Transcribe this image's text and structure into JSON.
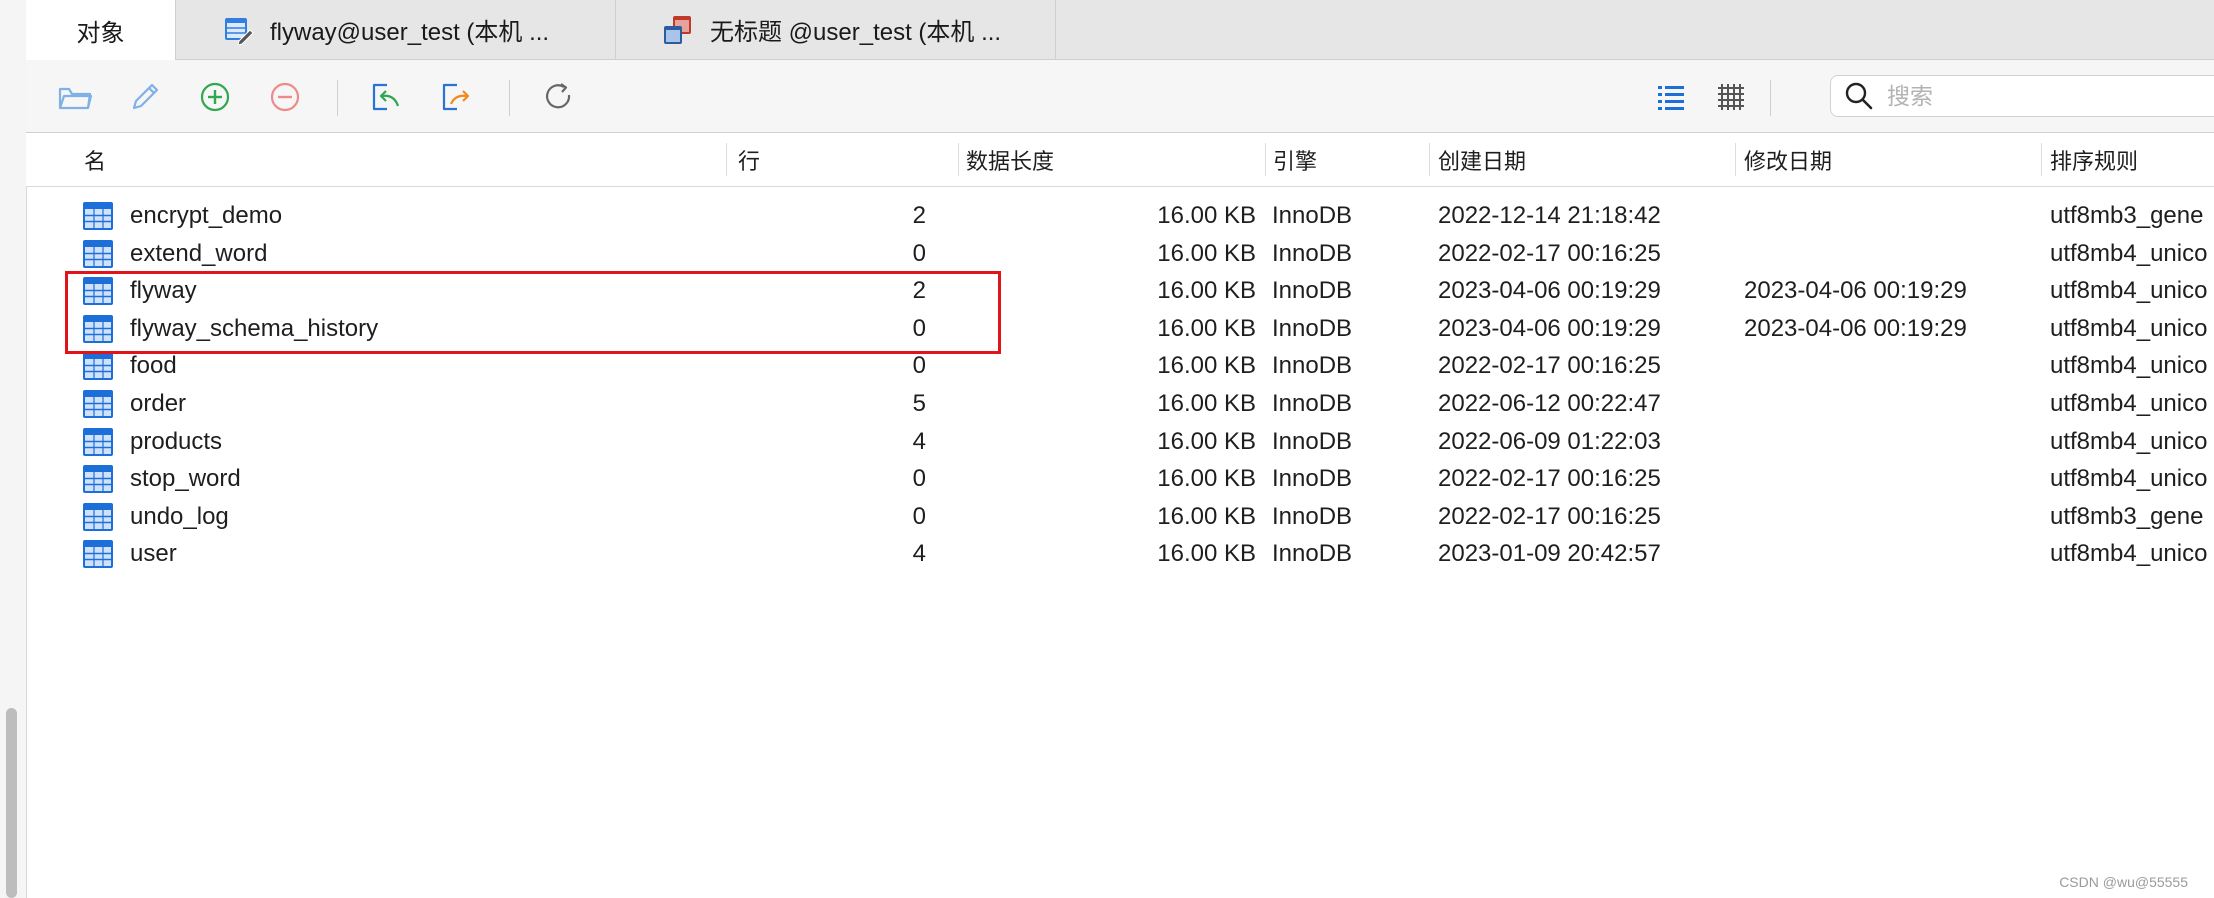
{
  "tabs": [
    {
      "label": "对象",
      "active": true,
      "icon": "objects"
    },
    {
      "label": "flyway@user_test (本机 ...",
      "active": false,
      "icon": "table-design-icon"
    },
    {
      "label": "无标题 @user_test (本机 ...",
      "active": false,
      "icon": "query-icon"
    }
  ],
  "toolbar": {
    "buttons": [
      "open-table-icon",
      "design-table-icon",
      "new-table-icon",
      "delete-table-icon",
      "import-icon",
      "export-icon",
      "refresh-icon"
    ],
    "list_view_icon": "list-view-icon",
    "grid_view_icon": "grid-view-icon"
  },
  "search": {
    "placeholder": "搜索"
  },
  "columns": {
    "name": "名",
    "rows": "行",
    "data_length": "数据长度",
    "engine": "引擎",
    "created": "创建日期",
    "modified": "修改日期",
    "collation": "排序规则"
  },
  "tables": [
    {
      "name": "encrypt_demo",
      "rows": "2",
      "data_length": "16.00 KB",
      "engine": "InnoDB",
      "created": "2022-12-14 21:18:42",
      "modified": "",
      "collation": "utf8mb3_gene"
    },
    {
      "name": "extend_word",
      "rows": "0",
      "data_length": "16.00 KB",
      "engine": "InnoDB",
      "created": "2022-02-17 00:16:25",
      "modified": "",
      "collation": "utf8mb4_unico"
    },
    {
      "name": "flyway",
      "rows": "2",
      "data_length": "16.00 KB",
      "engine": "InnoDB",
      "created": "2023-04-06 00:19:29",
      "modified": "2023-04-06 00:19:29",
      "collation": "utf8mb4_unico"
    },
    {
      "name": "flyway_schema_history",
      "rows": "0",
      "data_length": "16.00 KB",
      "engine": "InnoDB",
      "created": "2023-04-06 00:19:29",
      "modified": "2023-04-06 00:19:29",
      "collation": "utf8mb4_unico"
    },
    {
      "name": "food",
      "rows": "0",
      "data_length": "16.00 KB",
      "engine": "InnoDB",
      "created": "2022-02-17 00:16:25",
      "modified": "",
      "collation": "utf8mb4_unico"
    },
    {
      "name": "order",
      "rows": "5",
      "data_length": "16.00 KB",
      "engine": "InnoDB",
      "created": "2022-06-12 00:22:47",
      "modified": "",
      "collation": "utf8mb4_unico"
    },
    {
      "name": "products",
      "rows": "4",
      "data_length": "16.00 KB",
      "engine": "InnoDB",
      "created": "2022-06-09 01:22:03",
      "modified": "",
      "collation": "utf8mb4_unico"
    },
    {
      "name": "stop_word",
      "rows": "0",
      "data_length": "16.00 KB",
      "engine": "InnoDB",
      "created": "2022-02-17 00:16:25",
      "modified": "",
      "collation": "utf8mb4_unico"
    },
    {
      "name": "undo_log",
      "rows": "0",
      "data_length": "16.00 KB",
      "engine": "InnoDB",
      "created": "2022-02-17 00:16:25",
      "modified": "",
      "collation": "utf8mb3_gene"
    },
    {
      "name": "user",
      "rows": "4",
      "data_length": "16.00 KB",
      "engine": "InnoDB",
      "created": "2023-01-09 20:42:57",
      "modified": "",
      "collation": "utf8mb4_unico"
    }
  ],
  "row_icon": "table-icon",
  "annotation": {
    "highlight_color": "#e0141a"
  },
  "colors": {
    "accent": "#1c6fd9",
    "add_green": "#2fa84f",
    "remove_red": "#f08a8a"
  },
  "watermark": "CSDN @wu@55555"
}
